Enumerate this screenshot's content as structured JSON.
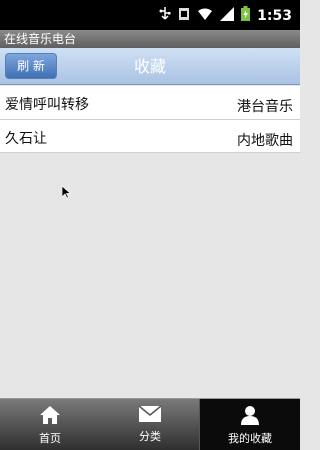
{
  "status_bar": {
    "time": "1:53",
    "icons": [
      "usb-icon",
      "notification-icon",
      "wifi-icon",
      "signal-icon",
      "battery-icon"
    ]
  },
  "app": {
    "title": "在线音乐电台"
  },
  "toolbar": {
    "refresh_label": "刷 新",
    "title": "收藏"
  },
  "favorites": [
    {
      "name": "爱情呼叫转移",
      "category": "港台音乐"
    },
    {
      "name": "久石让",
      "category": "内地歌曲"
    }
  ],
  "tabs": [
    {
      "label": "首页",
      "icon": "home-icon"
    },
    {
      "label": "分类",
      "icon": "mail-icon"
    },
    {
      "label": "我的收藏",
      "icon": "person-icon",
      "active": true
    }
  ],
  "colors": {
    "toolbar": "#b9d0ec",
    "refresh_button": "#4f7fc2",
    "background": "#e6e6e6",
    "tabbar": "#3a3a3a"
  }
}
